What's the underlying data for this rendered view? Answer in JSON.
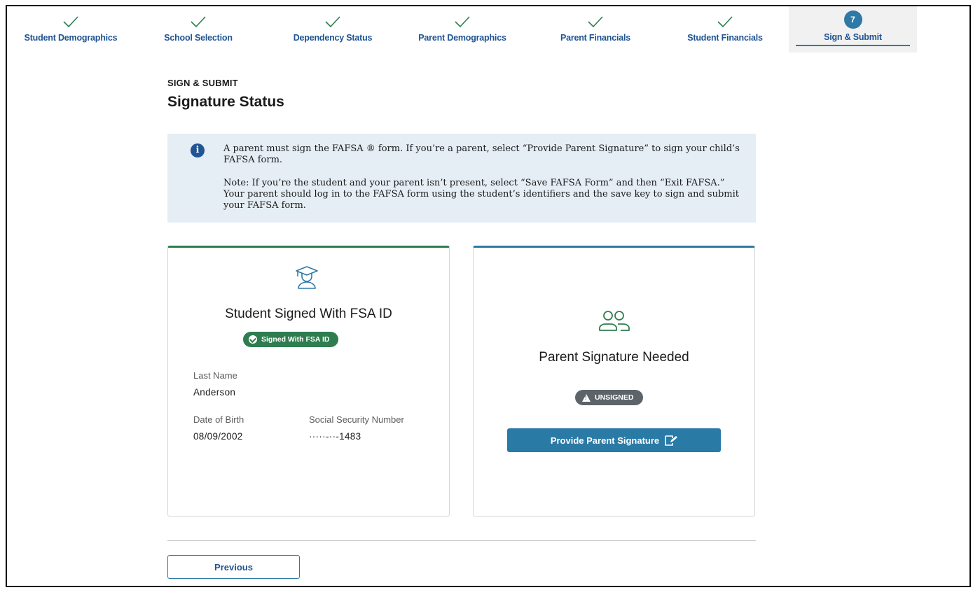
{
  "stepper": {
    "steps": [
      {
        "label": "Student Demographics",
        "status": "complete"
      },
      {
        "label": "School Selection",
        "status": "complete"
      },
      {
        "label": "Dependency Status",
        "status": "complete"
      },
      {
        "label": "Parent Demographics",
        "status": "complete"
      },
      {
        "label": "Parent Financials",
        "status": "complete"
      },
      {
        "label": "Student Financials",
        "status": "complete"
      },
      {
        "label": "Sign & Submit",
        "status": "current",
        "number": "7"
      }
    ]
  },
  "header": {
    "eyebrow": "SIGN & SUBMIT",
    "title": "Signature Status"
  },
  "alert": {
    "icon": "info-icon",
    "paragraph1": "A parent must sign the FAFSA ® form. If you’re a parent, select “Provide Parent Signature” to sign your child’s FAFSA form.",
    "paragraph2": "Note: If you’re the student and your parent isn’t present, select “Save FAFSA Form” and then “Exit FAFSA.” Your parent should log in to the FAFSA form using the student’s identifiers and the save key to sign and submit your FAFSA form."
  },
  "student_card": {
    "icon": "graduate-icon",
    "title": "Student Signed With FSA ID",
    "badge": "Signed With FSA ID",
    "last_name_label": "Last Name",
    "last_name_value": "Anderson",
    "dob_label": "Date of Birth",
    "dob_value": "08/09/2002",
    "ssn_label": "Social Security Number",
    "ssn_value": "·····-··-1483"
  },
  "parent_card": {
    "icon": "parents-icon",
    "title": "Parent Signature Needed",
    "badge": "UNSIGNED",
    "button_label": "Provide Parent Signature"
  },
  "footer": {
    "previous_label": "Previous"
  },
  "colors": {
    "primary": "#2e79a5",
    "link": "#205493",
    "success": "#2e7d4f",
    "alert_bg": "#e5eef5",
    "unsigned": "#5d6469"
  }
}
